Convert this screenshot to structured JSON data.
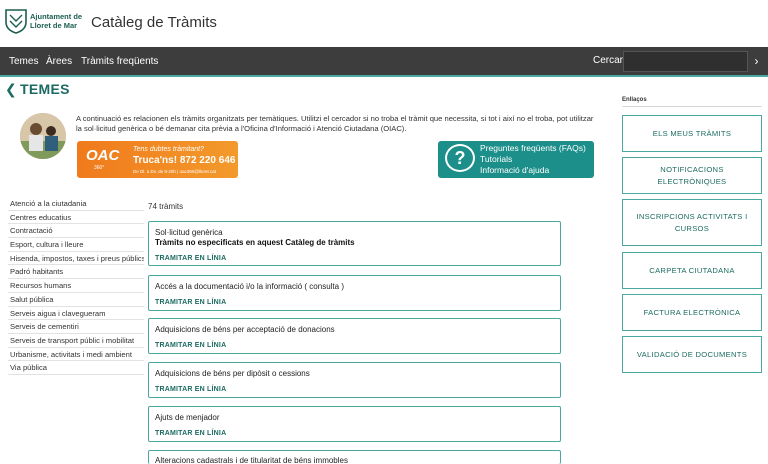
{
  "header": {
    "logo_line1": "Ajuntament de",
    "logo_line2": "Lloret de Mar",
    "title": "Catàleg de Tràmits"
  },
  "nav": {
    "items": [
      "Temes",
      "Àrees",
      "Tràmits freqüents"
    ],
    "search_label": "Cercar",
    "search_placeholder": ""
  },
  "page": {
    "title": "TEMES",
    "intro": "A continuació es relacionen els tràmits organitzats per temàtiques. Utilitzi el cercador si no troba el tràmit que necessita, si tot i així no el troba, pot utilitzar la sol·licitud genèrica o bé demanar cita prèvia a l'Oficina d'Informació i Atenció Ciutadana (OIAC).",
    "oac_banner": {
      "brand": "OAC",
      "brand_sub": "360°",
      "line1": "Tens dubtes tràmitant?",
      "line2": "Truca'ns! 872 220 646",
      "line3": "De Dl. a Dv. de 8-20h | oac360@lloret.cat"
    },
    "faq_banner": {
      "line1": "Preguntes freqüents (FAQs)",
      "line2": "Tutorials",
      "line3": "Informació d'ajuda"
    },
    "count": "74 tràmits"
  },
  "themes": [
    "Atenció a la ciutadania",
    "Centres educatius",
    "Contractació",
    "Esport, cultura i lleure",
    "Hisenda, impostos, taxes i preus públics",
    "Padró habitants",
    "Recursos humans",
    "Salut pública",
    "Serveis aigua i clavegueram",
    "Serveis de cementiri",
    "Serveis de transport públic i mobilitat",
    "Urbanisme, activitats i medi ambient",
    "Via pública"
  ],
  "procedures": [
    {
      "title": "Sol·licitud genèrica",
      "subtitle": "Tràmits no especificats en aquest Catàleg de tràmits",
      "action": "TRAMITAR EN LÍNIA"
    },
    {
      "title": "Accés a la documentació i/o la informació ( consulta )",
      "subtitle": "",
      "action": "TRAMITAR EN LÍNIA"
    },
    {
      "title": "Adquisicions de béns per acceptació de donacions",
      "subtitle": "",
      "action": "TRAMITAR EN LÍNIA"
    },
    {
      "title": "Adquisicions de béns per dipòsit o cessions",
      "subtitle": "",
      "action": "TRAMITAR EN LÍNIA"
    },
    {
      "title": "Ajuts de menjador",
      "subtitle": "",
      "action": "TRAMITAR EN LÍNIA"
    },
    {
      "title": "Alteracions cadastrals i de titularitat de béns immobles",
      "subtitle": "",
      "action": ""
    }
  ],
  "links": {
    "label": "Enllaços",
    "items": [
      "ELS MEUS TRÀMITS",
      "NOTIFICACIONS ELECTRÒNIQUES",
      "INSCRIPCIONS ACTIVITATS I CURSOS",
      "CARPETA CIUTADANA",
      "FACTURA ELECTRÒNICA",
      "VALIDACIÓ DE DOCUMENTS"
    ]
  },
  "colors": {
    "accent": "#1c6b62",
    "border": "#4aa8a0",
    "nav_bg": "#3d3d3d",
    "oac_orange": "#f07a1c",
    "faq_teal": "#1d8f8a"
  }
}
